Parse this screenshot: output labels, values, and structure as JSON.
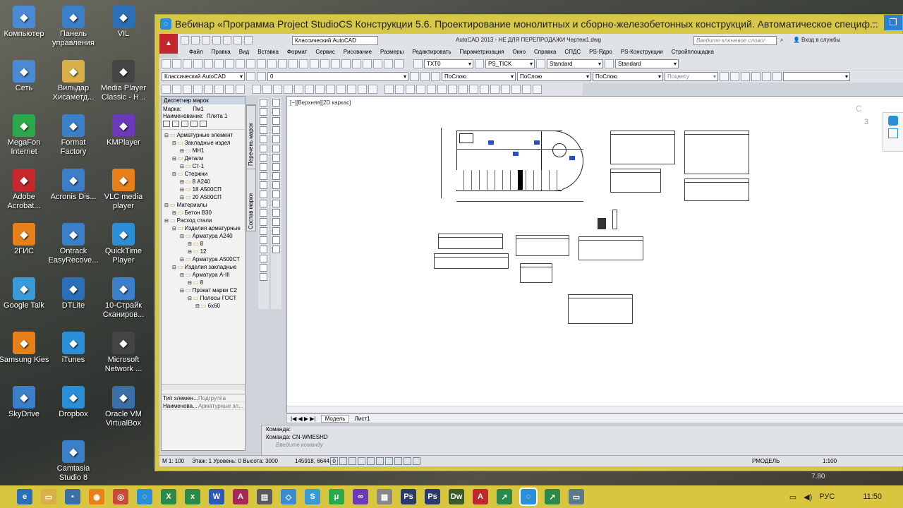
{
  "desktop_icons": [
    {
      "label": "Компьютер",
      "icon": "computer-icon",
      "color": "#4a8ad4"
    },
    {
      "label": "Панель управления",
      "icon": "control-panel-icon",
      "color": "#3a7fc8"
    },
    {
      "label": "VIL",
      "icon": "user-folder-icon",
      "color": "#2b6fb8"
    },
    {
      "label": "Сеть",
      "icon": "network-icon",
      "color": "#4a8ad4"
    },
    {
      "label": "Вильдар Хисаметд...",
      "icon": "folder-icon",
      "color": "#d8b04a"
    },
    {
      "label": "Media Player Classic - H...",
      "icon": "media-player-icon",
      "color": "#444"
    },
    {
      "label": "MegaFon Internet",
      "icon": "megafon-icon",
      "color": "#2ba84a"
    },
    {
      "label": "Format Factory",
      "icon": "format-factory-icon",
      "color": "#3a7fc8"
    },
    {
      "label": "KMPlayer",
      "icon": "kmplayer-icon",
      "color": "#6a3ab8"
    },
    {
      "label": "Adobe Acrobat...",
      "icon": "acrobat-icon",
      "color": "#c8282d"
    },
    {
      "label": "Acronis Dis...",
      "icon": "acronis-icon",
      "color": "#3a7fc8"
    },
    {
      "label": "VLC media player",
      "icon": "vlc-icon",
      "color": "#e8801a"
    },
    {
      "label": "2ГИС",
      "icon": "2gis-icon",
      "color": "#e8801a"
    },
    {
      "label": "Ontrack EasyRecove...",
      "icon": "ontrack-icon",
      "color": "#3a7fc8"
    },
    {
      "label": "QuickTime Player",
      "icon": "quicktime-icon",
      "color": "#2b8fd8"
    },
    {
      "label": "Google Talk",
      "icon": "google-talk-icon",
      "color": "#3a9ad8"
    },
    {
      "label": "DTLite",
      "icon": "dtlite-icon",
      "color": "#2b6fb8"
    },
    {
      "label": "10-Страйк Сканиров...",
      "icon": "scanner-icon",
      "color": "#3a7fc8"
    },
    {
      "label": "Samsung Kies",
      "icon": "kies-icon",
      "color": "#e8801a"
    },
    {
      "label": "iTunes",
      "icon": "itunes-icon",
      "color": "#2b8fd8"
    },
    {
      "label": "Microsoft Network ...",
      "icon": "network-monitor-icon",
      "color": "#444"
    },
    {
      "label": "SkyDrive",
      "icon": "skydrive-icon",
      "color": "#3a7fc8"
    },
    {
      "label": "Dropbox",
      "icon": "dropbox-icon",
      "color": "#2b8fd8"
    },
    {
      "label": "Oracle VM VirtualBox",
      "icon": "virtualbox-icon",
      "color": "#3a6fa8"
    },
    {
      "label": "Camtasia Studio 8",
      "icon": "camtasia-icon",
      "color": "#3a7fc8"
    }
  ],
  "window": {
    "title": "Вебинар «Программа Project StudioCS Конструкции 5.6. Проектирование монолитных и сборно-железобетонных конструкций. Автоматическое специф...",
    "minimize": "–"
  },
  "acad": {
    "title": "AutoCAD 2013 - НЕ ДЛЯ ПЕРЕПРОДАЖИ   Чертеж1.dwg",
    "workspace": "Классический AutoCAD",
    "search_placeholder": "Введите ключевое слово/фразу",
    "signin": "Вход в службы",
    "menus": [
      "Файл",
      "Правка",
      "Вид",
      "Вставка",
      "Формат",
      "Сервис",
      "Рисование",
      "Размеры",
      "Редактировать",
      "Параметризация",
      "Окно",
      "Справка",
      "СПДС",
      "PS-Ядро",
      "PS-Конструкции",
      "Стройплощадка"
    ],
    "toolbar": {
      "text_style": "TXT0",
      "dim_style": "PS_TICK",
      "table_style": "Standard",
      "mleader_style": "Standard",
      "workspace2": "Классический AutoCAD",
      "layer": "0",
      "color": "ПоСлою",
      "linetype": "ПоСлою",
      "lineweight": "ПоСлою",
      "plotstyle": "Поцвету"
    }
  },
  "panel": {
    "title": "Диспетчер марок",
    "mark_label": "Марка:",
    "mark_value": "Пм1",
    "name_label": "Наименование:",
    "name_value": "Плита 1",
    "tree": [
      {
        "t": "Арматурные элемент",
        "d": 0
      },
      {
        "t": "Закладные издел",
        "d": 1
      },
      {
        "t": "МН1",
        "d": 2
      },
      {
        "t": "Детали",
        "d": 1
      },
      {
        "t": "Ст-1",
        "d": 2
      },
      {
        "t": "Стержни",
        "d": 1
      },
      {
        "t": "8 А240",
        "d": 2
      },
      {
        "t": "18 А500СП",
        "d": 2
      },
      {
        "t": "20 А500СП",
        "d": 2
      },
      {
        "t": "Материалы",
        "d": 0
      },
      {
        "t": "Бетон В30",
        "d": 1
      },
      {
        "t": "Расход стали",
        "d": 0
      },
      {
        "t": "Изделия арматурные",
        "d": 1
      },
      {
        "t": "Арматура А240",
        "d": 2
      },
      {
        "t": "8",
        "d": 3
      },
      {
        "t": "12",
        "d": 3
      },
      {
        "t": "Арматура А500СТ",
        "d": 2
      },
      {
        "t": "Изделия закладные",
        "d": 1
      },
      {
        "t": "Арматура А-III",
        "d": 2
      },
      {
        "t": "8",
        "d": 3
      },
      {
        "t": "Прокат марки С2",
        "d": 2
      },
      {
        "t": "Полосы ГОСТ",
        "d": 3
      },
      {
        "t": "6х60",
        "d": 4
      }
    ],
    "props": [
      {
        "k": "Тип элемен...",
        "v": "Подгруппа"
      },
      {
        "k": "Наименова...",
        "v": "Арматурные эл..."
      }
    ],
    "side_tabs": [
      "Перечень марок",
      "Состав марки"
    ]
  },
  "canvas": {
    "view_label": "[−][Верхняя][2D каркас]",
    "nav_number": "3"
  },
  "tabs": [
    "Модель",
    "Лист1"
  ],
  "command": {
    "line1": "Команда:",
    "line2": "Команда:  CN-WMESHD",
    "placeholder": "Введите команду"
  },
  "statusbar": {
    "scale": "М 1: 100",
    "info": "Этаж: 1 Уровень: 0 Высота: 3000",
    "coords": "145918, 6644, 0",
    "model": "РМОДЕЛЬ",
    "annot_scale": "1:100"
  },
  "clock": {
    "time": "11:50",
    "lang": "РУС",
    "watermark": "7.80"
  }
}
